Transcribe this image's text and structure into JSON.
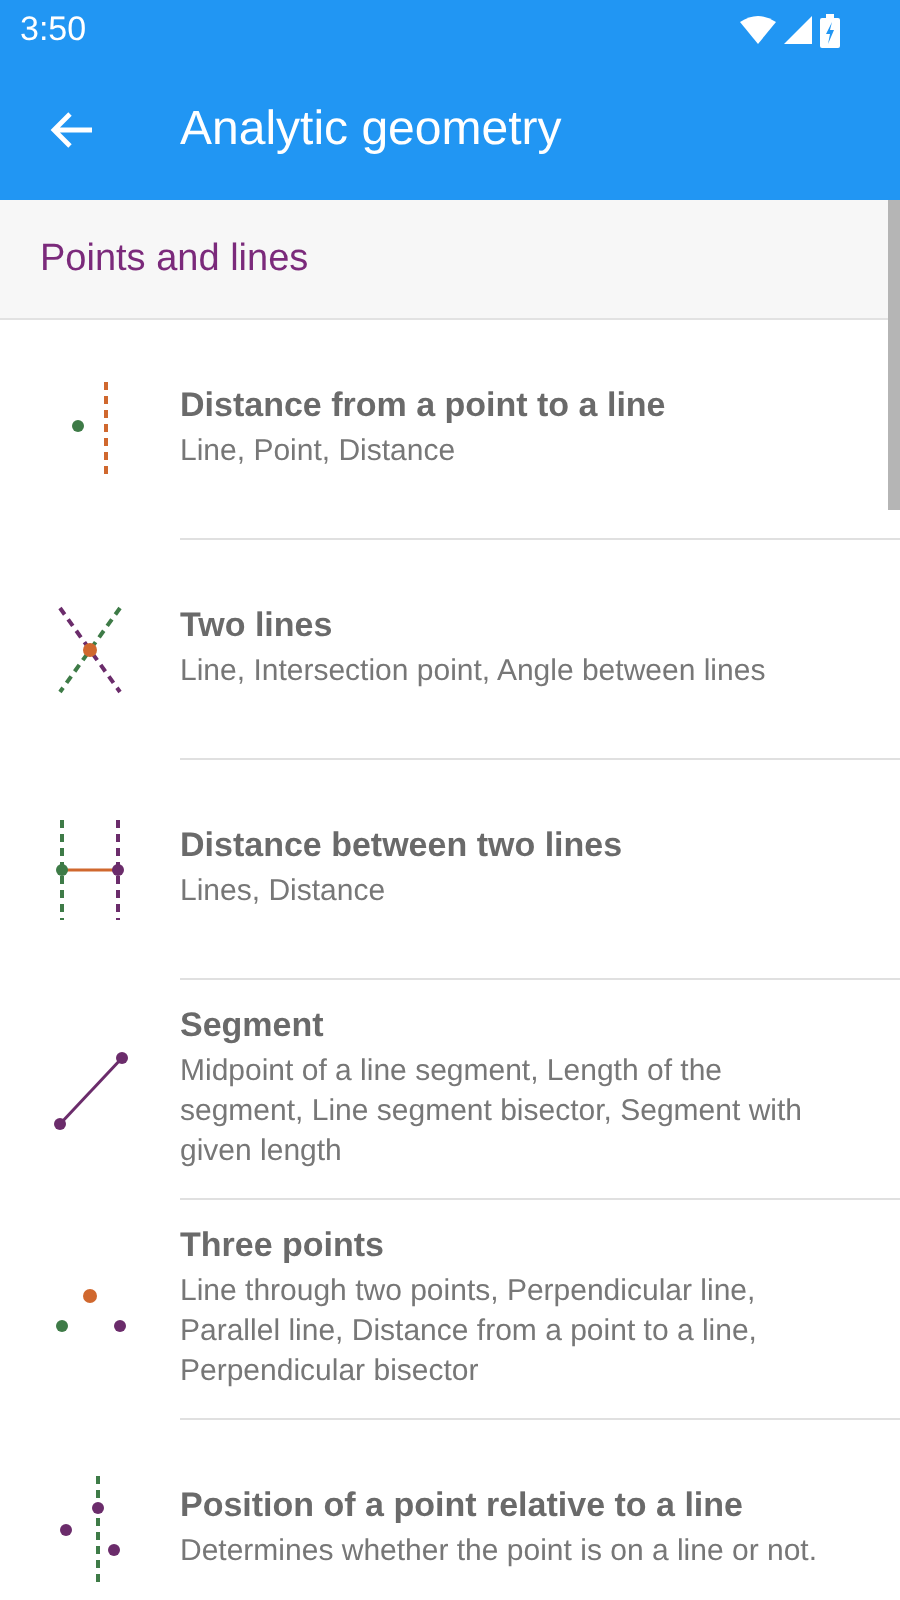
{
  "status_bar": {
    "time": "3:50"
  },
  "app_bar": {
    "title": "Analytic geometry"
  },
  "section": {
    "title": "Points and lines"
  },
  "items": [
    {
      "kind": "point-line",
      "title": "Distance from a point to a line",
      "subtitle": "Line, Point, Distance"
    },
    {
      "kind": "two-lines",
      "title": "Two lines",
      "subtitle": "Line, Intersection point, Angle between lines"
    },
    {
      "kind": "parallel-lines",
      "title": "Distance between two lines",
      "subtitle": "Lines, Distance"
    },
    {
      "kind": "segment",
      "title": "Segment",
      "subtitle": "Midpoint of a line segment, Length of the segment, Line segment bisector, Segment with given length"
    },
    {
      "kind": "three-points",
      "title": "Three points",
      "subtitle": "Line through two points, Perpendicular line, Parallel line, Distance from a point to a line, Perpendicular bisector"
    },
    {
      "kind": "point-position",
      "title": "Position of a point relative to a line",
      "subtitle": "Determines whether the point is on a line or not."
    }
  ]
}
